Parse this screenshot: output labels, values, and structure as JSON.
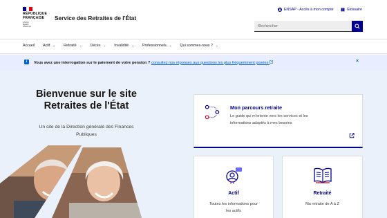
{
  "header": {
    "republique_lines": [
      "RÉPUBLIQUE",
      "FRANÇAISE"
    ],
    "motto_lines": [
      "Liberté",
      "Égalité",
      "Fraternité"
    ],
    "site_title": "Service des Retraites de l'État",
    "tool_links": [
      {
        "label": "ENSAP - Accès à mon compte",
        "icon": "user-icon"
      },
      {
        "label": "Glossaire",
        "icon": "book-icon"
      }
    ],
    "search_placeholder": "Rechercher"
  },
  "nav": {
    "items": [
      {
        "label": "Accueil",
        "dropdown": false
      },
      {
        "label": "Actif",
        "dropdown": true
      },
      {
        "label": "Retraité",
        "dropdown": true
      },
      {
        "label": "Décès",
        "dropdown": true
      },
      {
        "label": "Invalidité",
        "dropdown": true
      },
      {
        "label": "Professionnels",
        "dropdown": true
      },
      {
        "label": "Qui sommes-nous ?",
        "dropdown": true
      }
    ]
  },
  "notice": {
    "question": "Vous avez une interrogation sur le paiement de votre pension ?",
    "link": "consultez nos réponses aux questions les plus fréquemment posées"
  },
  "hero": {
    "title_line1": "Bienvenue sur le site",
    "title_line2": "Retraites de l'État",
    "subtitle_line1": "Un site de la Direction générale des Finances",
    "subtitle_line2": "Publiques"
  },
  "cards": {
    "parcours": {
      "title": "Mon parcours retraite",
      "desc_line1": "Le guide qui m'oriente vers les services et les",
      "desc_line2": "informations adaptés à mes besoins"
    },
    "actif": {
      "title": "Actif",
      "desc_line1": "Toutes les informations pour",
      "desc_line2": "les actifs"
    },
    "retraite": {
      "title": "Retraité",
      "desc_line1": "Ma retraite de A à Z"
    }
  },
  "colors": {
    "primary": "#000091",
    "notice_bg": "#e8edff",
    "hero_bg": "#ebf1fa",
    "accent_red": "#e1000f"
  }
}
